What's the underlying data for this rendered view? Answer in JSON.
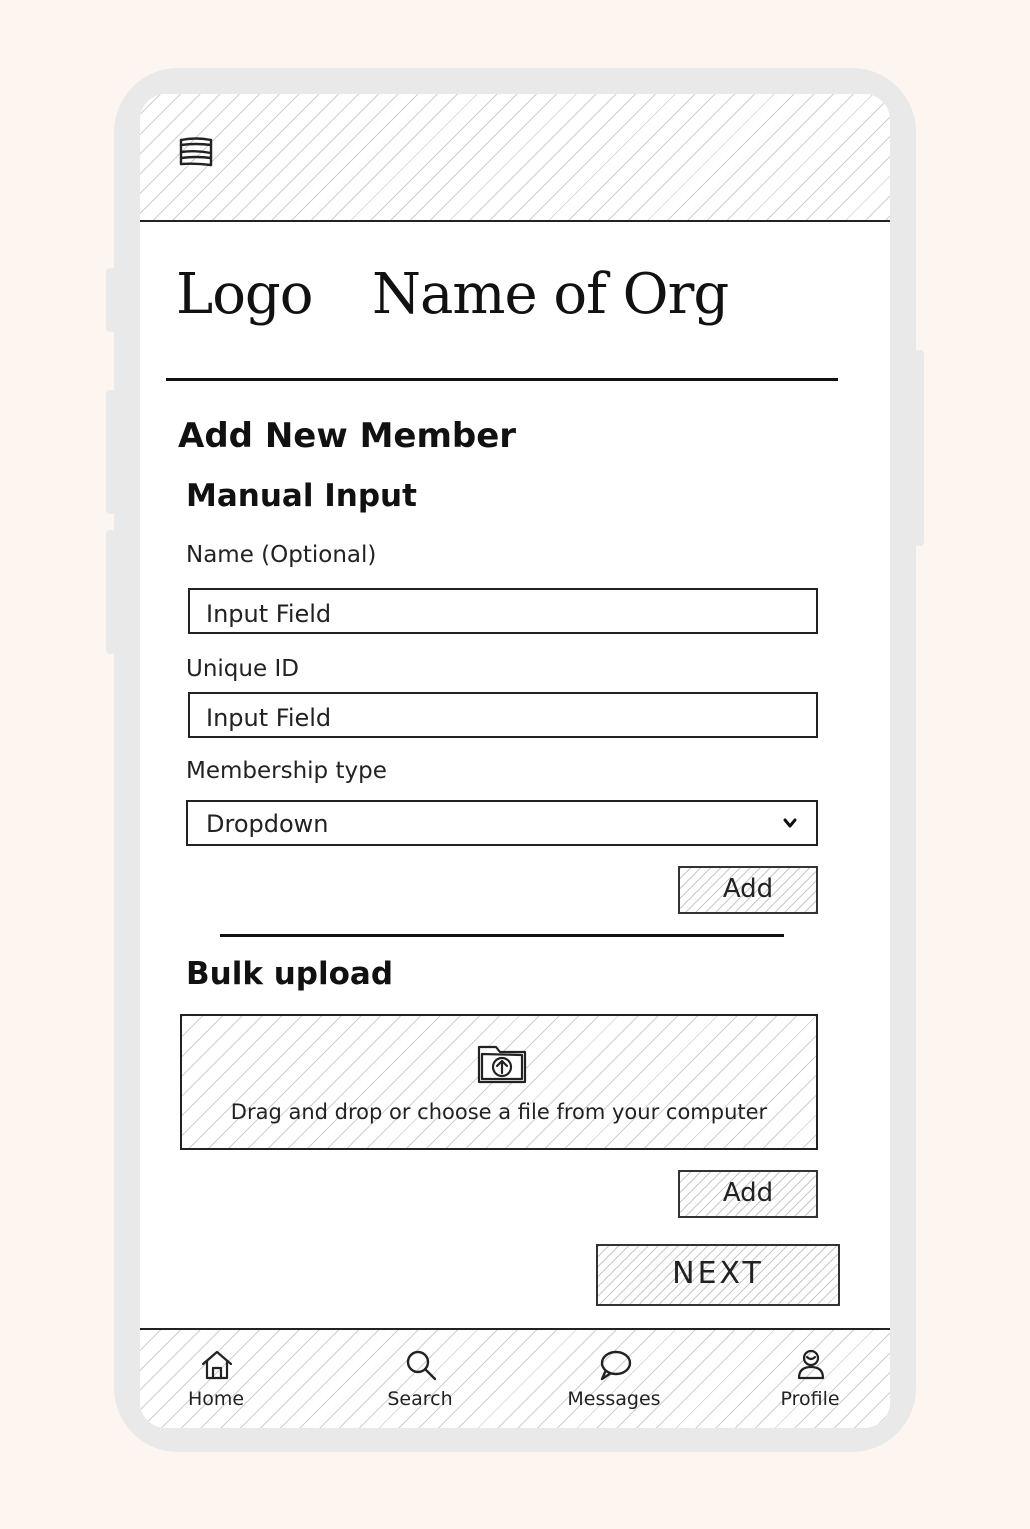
{
  "header": {
    "logo_text": "Logo",
    "org_name": "Name of Org"
  },
  "page": {
    "title": "Add New Member"
  },
  "manual": {
    "heading": "Manual Input",
    "name_label": "Name (Optional)",
    "name_placeholder": "Input Field",
    "id_label": "Unique ID",
    "id_placeholder": "Input Field",
    "membership_label": "Membership type",
    "membership_value": "Dropdown",
    "add_label": "Add"
  },
  "bulk": {
    "heading": "Bulk upload",
    "dropzone_text": "Drag and drop or choose a file from your computer",
    "add_label": "Add"
  },
  "next_label": "NEXT",
  "nav": {
    "items": [
      {
        "label": "Home",
        "icon": "home-icon"
      },
      {
        "label": "Search",
        "icon": "search-icon"
      },
      {
        "label": "Messages",
        "icon": "chat-bubble-icon"
      },
      {
        "label": "Profile",
        "icon": "profile-icon"
      }
    ]
  }
}
